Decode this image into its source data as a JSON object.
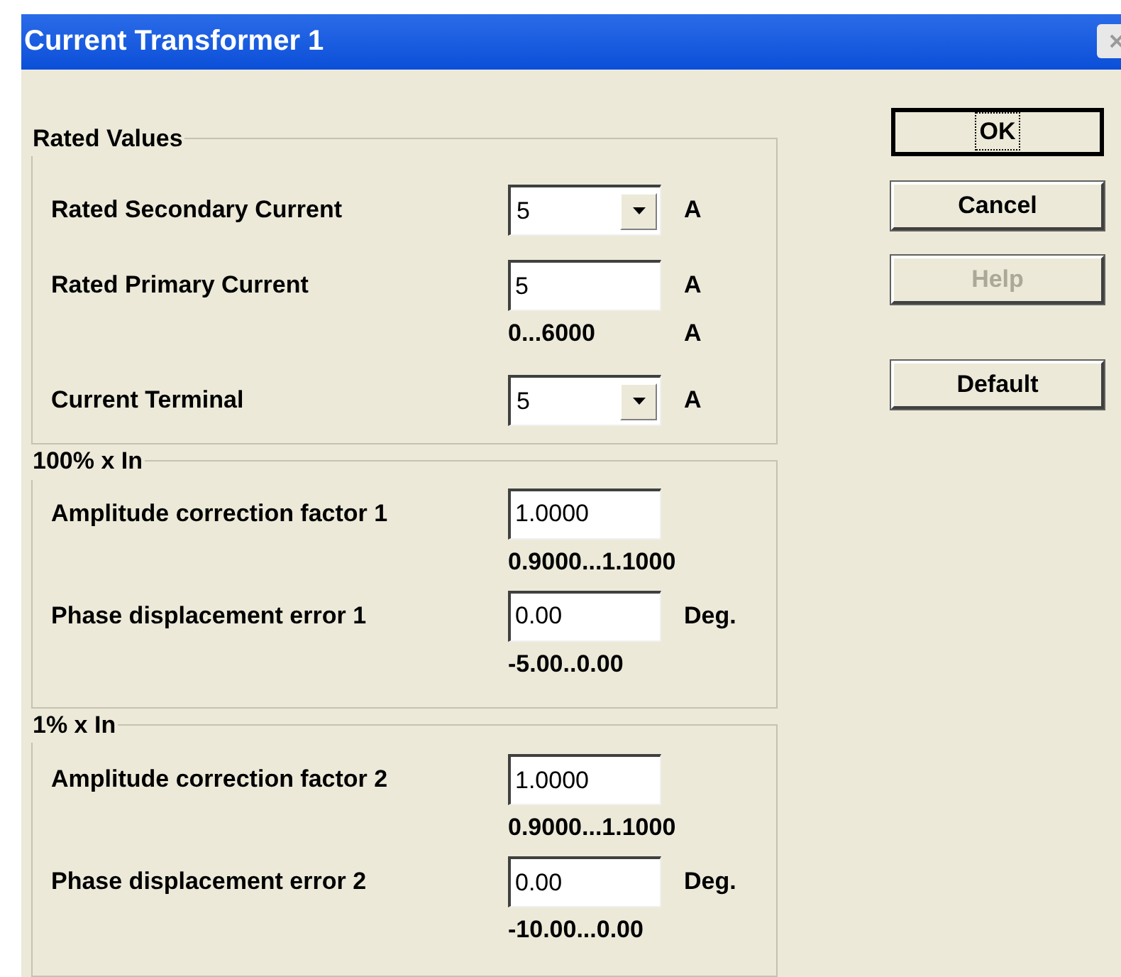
{
  "window": {
    "title": "Current Transformer 1"
  },
  "groups": [
    {
      "title": "Rated Values",
      "rows": [
        {
          "kind": "dropdown",
          "label": "Rated Secondary Current",
          "value": "5",
          "unit": "A"
        },
        {
          "kind": "field",
          "label": "Rated Primary Current",
          "value": "5",
          "unit": "A",
          "range": "0...6000",
          "range_unit": "A"
        },
        {
          "kind": "dropdown",
          "label": "Current Terminal",
          "value": "5",
          "unit": "A"
        }
      ]
    },
    {
      "title": "100% x In",
      "rows": [
        {
          "kind": "field",
          "label": "Amplitude correction factor 1",
          "value": "1.0000",
          "range": "0.9000...1.1000"
        },
        {
          "kind": "field",
          "label": "Phase displacement error 1",
          "value": "0.00",
          "unit": "Deg.",
          "range": "-5.00..0.00"
        }
      ]
    },
    {
      "title": "1% x In",
      "rows": [
        {
          "kind": "field",
          "label": "Amplitude correction factor 2",
          "value": "1.0000",
          "range": "0.9000...1.1000"
        },
        {
          "kind": "field",
          "label": "Phase displacement error 2",
          "value": "0.00",
          "unit": "Deg.",
          "range": "-10.00...0.00"
        }
      ]
    }
  ],
  "buttons": [
    {
      "label": "OK",
      "default": true,
      "disabled": false
    },
    {
      "label": "Cancel",
      "default": false,
      "disabled": false
    },
    {
      "label": "Help",
      "default": false,
      "disabled": true
    },
    {
      "label": "Default",
      "default": false,
      "disabled": false
    }
  ]
}
